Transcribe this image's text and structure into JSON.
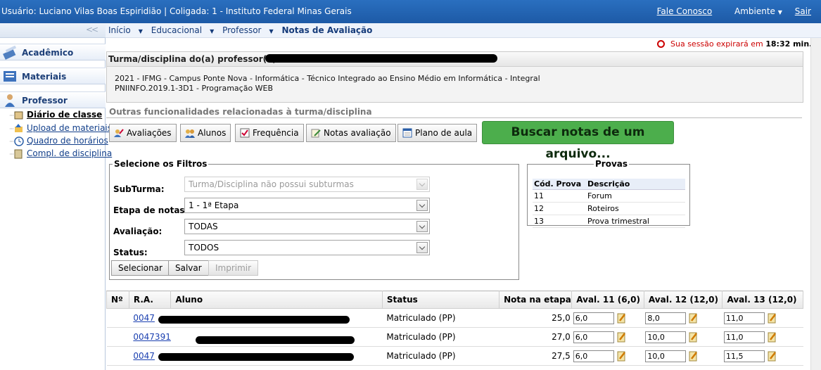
{
  "topbar": {
    "user": "Usuário: Luciano Vilas Boas Espiridião  |  Coligada: 1 - Instituto Federal Minas Gerais",
    "contact": "Fale Conosco",
    "ambiente": "Ambiente",
    "exit": "Sair"
  },
  "sidebar": {
    "collapse": "<<",
    "sections": [
      "Acadêmico",
      "Materiais",
      "Professor"
    ],
    "items": [
      "Diário de classe",
      "Upload de materiais",
      "Quadro de horários",
      "Compl. de disciplina"
    ]
  },
  "breadcrumb": {
    "items": [
      "Início",
      "Educacional",
      "Professor"
    ],
    "current": "Notas de Avaliação"
  },
  "session": {
    "text": "Sua sessão expirará em",
    "time": "18:32 min."
  },
  "turma": {
    "header": "Turma/disciplina do(a) professor(a)",
    "line1": "2021 - IFMG - Campus Ponte Nova - Informática - Técnico Integrado ao Ensino Médio em Informática - Integral",
    "line2": "PNIINFO.2019.1-3D1 - Programação WEB"
  },
  "outras": "Outras funcionalidades relacionadas à turma/disciplina",
  "toolbar": {
    "avaliacoes": "Avaliações",
    "alunos": "Alunos",
    "frequencia": "Frequência",
    "notas": "Notas avaliação",
    "plano": "Plano de aula",
    "buscar": "Buscar notas de um arquivo..."
  },
  "filtros": {
    "legend": "Selecione os Filtros",
    "subturma_label": "SubTurma:",
    "subturma_value": "Turma/Disciplina não possui subturmas",
    "etapa_label": "Etapa de notas:",
    "etapa_value": "1 - 1ª Etapa",
    "avaliacao_label": "Avaliação:",
    "avaliacao_value": "TODAS",
    "status_label": "Status:",
    "status_value": "TODOS",
    "btn_selecionar": "Selecionar",
    "btn_salvar": "Salvar",
    "btn_imprimir": "Imprimir"
  },
  "provas": {
    "legend": "Provas",
    "headers": [
      "Cód. Prova",
      "Descrição"
    ],
    "rows": [
      [
        "11",
        "Forum"
      ],
      [
        "12",
        "Roteiros"
      ],
      [
        "13",
        "Prova trimestral"
      ]
    ]
  },
  "notas": {
    "headers": [
      "Nº",
      "R.A.",
      "Aluno",
      "Status",
      "Nota na etapa",
      "Aval. 11 (6,0)",
      "Aval. 12 (12,0)",
      "Aval. 13 (12,0)"
    ],
    "rows": [
      {
        "ra": "0047",
        "status": "Matriculado (PP)",
        "nota": "25,0",
        "a11": "6,0",
        "a12": "8,0",
        "a13": "11,0"
      },
      {
        "ra": "0047391",
        "status": "Matriculado (PP)",
        "nota": "27,0",
        "a11": "6,0",
        "a12": "10,0",
        "a13": "11,0"
      },
      {
        "ra": "0047",
        "status": "Matriculado (PP)",
        "nota": "27,5",
        "a11": "6,0",
        "a12": "10,0",
        "a13": "11,5"
      }
    ]
  },
  "colors": {
    "topbar": "#1d5aa6",
    "buscar": "#4cae4c",
    "link": "#123f8a",
    "timer": "#cc0000"
  }
}
